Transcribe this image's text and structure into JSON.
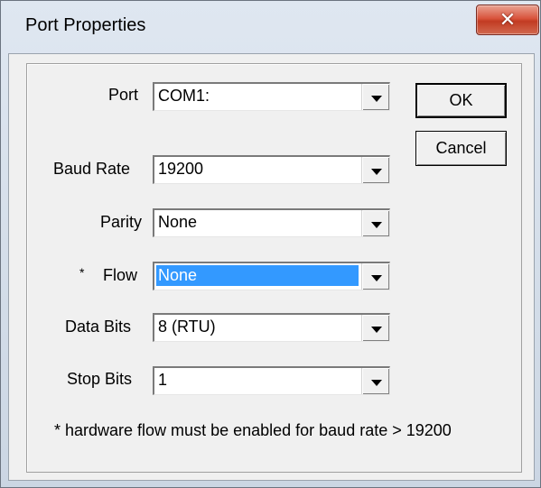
{
  "window": {
    "title": "Port Properties",
    "close_glyph": "✕"
  },
  "fields": {
    "port": {
      "label": "Port",
      "value": "COM1:"
    },
    "baud_rate": {
      "label": "Baud Rate",
      "value": "19200"
    },
    "parity": {
      "label": "Parity",
      "value": "None"
    },
    "flow": {
      "label": "Flow",
      "marker": "*",
      "value": "None"
    },
    "data_bits": {
      "label": "Data Bits",
      "value": "8 (RTU)"
    },
    "stop_bits": {
      "label": "Stop Bits",
      "value": "1"
    }
  },
  "buttons": {
    "ok": "OK",
    "cancel": "Cancel"
  },
  "footnote": "* hardware flow must be enabled for baud rate > 19200",
  "colors": {
    "selection": "#3399ff",
    "close_button": "#c23b22"
  },
  "icons": {
    "close": "close-icon",
    "dropdown": "chevron-down-icon"
  }
}
